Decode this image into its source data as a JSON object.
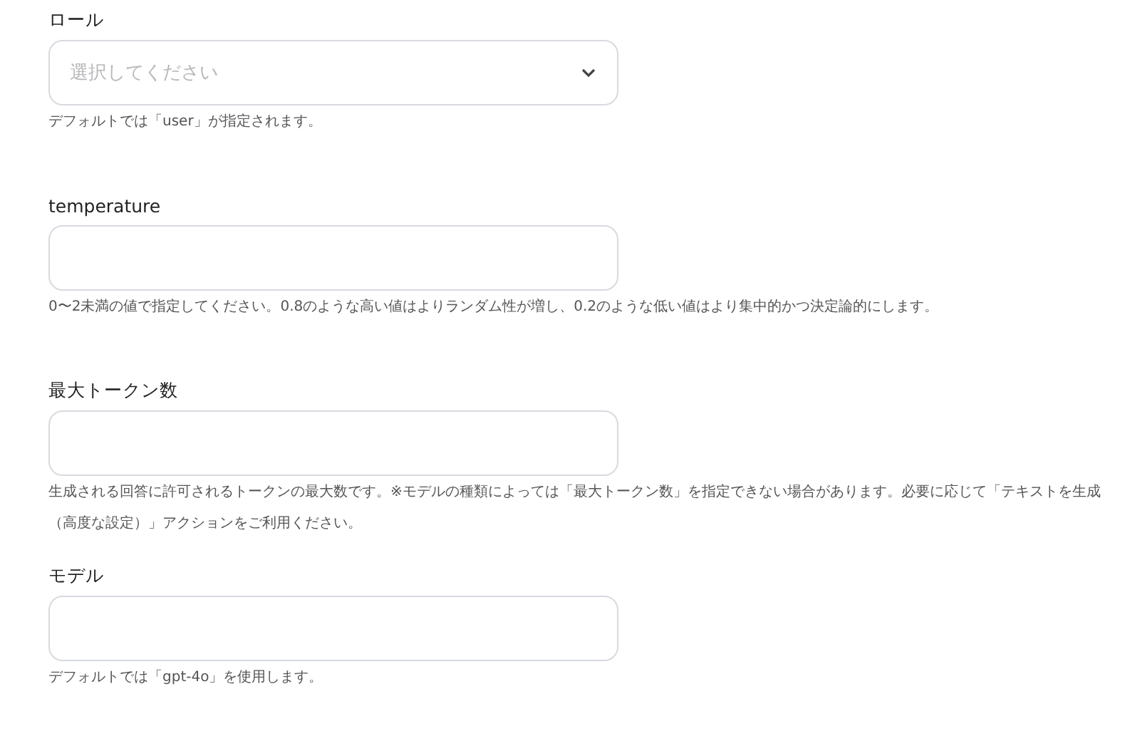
{
  "fields": [
    {
      "kind": "select",
      "label": "ロール",
      "placeholder": "選択してください",
      "hint": "デフォルトでは「user」が指定されます。"
    },
    {
      "kind": "text",
      "label": "temperature",
      "hint": "0〜2未満の値で指定してください。0.8のような高い値はよりランダム性が増し、0.2のような低い値はより集中的かつ決定論的にします。"
    },
    {
      "kind": "text",
      "label": "最大トークン数",
      "hint": "生成される回答に許可されるトークンの最大数です。※モデルの種類によっては「最大トークン数」を指定できない場合があります。必要に応じて「テキストを生成（高度な設定）」アクションをご利用ください。"
    },
    {
      "kind": "text",
      "label": "モデル",
      "hint": "デフォルトでは「gpt-4o」を使用します。"
    }
  ]
}
